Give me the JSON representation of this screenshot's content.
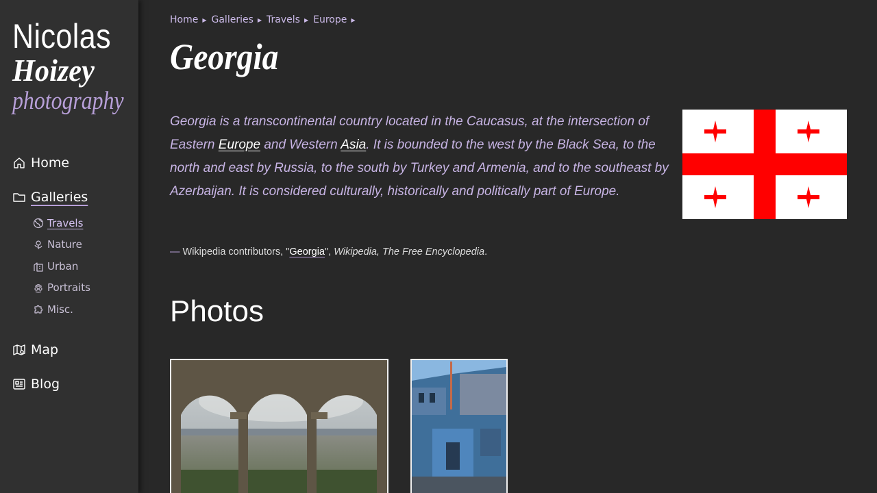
{
  "logo": {
    "first": "Nicolas",
    "last": "Hoizey",
    "sub": "photography"
  },
  "nav": {
    "home": {
      "label": "Home",
      "icon": "home-icon"
    },
    "galleries": {
      "label": "Galleries",
      "icon": "folder-icon"
    },
    "sub": [
      {
        "label": "Travels",
        "icon": "globe-icon",
        "active": true
      },
      {
        "label": "Nature",
        "icon": "flower-icon"
      },
      {
        "label": "Urban",
        "icon": "building-icon"
      },
      {
        "label": "Portraits",
        "icon": "person-icon"
      },
      {
        "label": "Misc.",
        "icon": "puzzle-icon"
      }
    ],
    "map": {
      "label": "Map",
      "icon": "map-icon"
    },
    "blog": {
      "label": "Blog",
      "icon": "news-icon"
    }
  },
  "breadcrumb": [
    "Home",
    "Galleries",
    "Travels",
    "Europe"
  ],
  "page_title": "Georgia",
  "quote": {
    "part1": "Georgia is a transcontinental country located in the Caucasus, at the intersection of Eastern ",
    "link1": "Europe",
    "part2": " and Western ",
    "link2": "Asia",
    "part3": ". It is bounded to the west by the Black Sea, to the north and east by Russia, to the south by Turkey and Armenia, and to the southeast by Azerbaijan. It is considered culturally, historically and politically part of Europe."
  },
  "attribution": {
    "dash": "—",
    "before": " Wikipedia contributors, \"",
    "link": "Georgia",
    "after": "\", ",
    "source": "Wikipedia, The Free Encyclopedia",
    "end": "."
  },
  "section_title": "Photos",
  "colors": {
    "accent": "#b79fd8",
    "flag_red": "#ff0000",
    "background": "#282828",
    "sidebar": "#303030"
  }
}
